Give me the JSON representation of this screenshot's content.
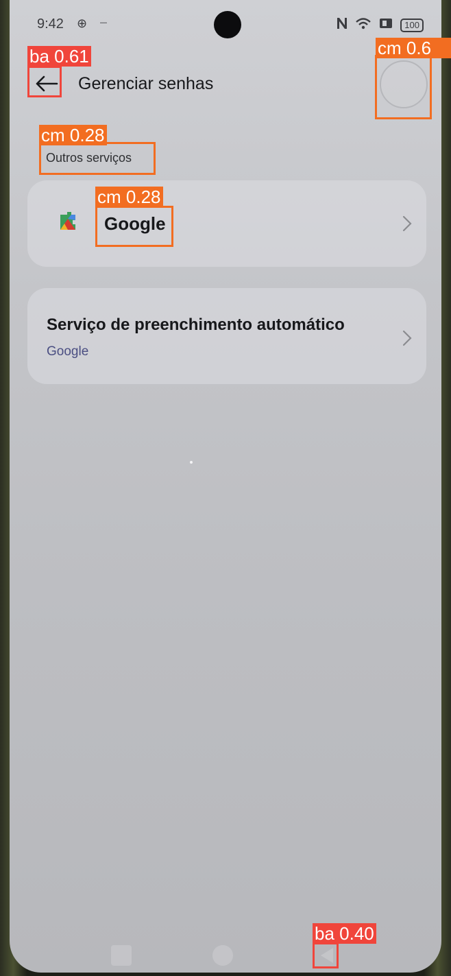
{
  "status_bar": {
    "time": "9:42",
    "sync_icon": "⊕",
    "dash": "–",
    "nfc_icon": "nfc-icon",
    "wifi_icon": "wifi-icon",
    "battery": "100"
  },
  "header": {
    "title": "Gerenciar senhas",
    "back_icon": "arrow-left-icon"
  },
  "section_label": "Outros serviços",
  "google_item": {
    "label": "Google",
    "icon": "google-play-services-icon"
  },
  "autofill_item": {
    "title": "Serviço de preenchimento automático",
    "subtitle": "Google"
  },
  "detections": [
    {
      "label": "ba 0.61",
      "color": "#f0453b"
    },
    {
      "label": "cm 0.6",
      "color": "#f26d21"
    },
    {
      "label": "cm 0.28",
      "color": "#f26d21"
    },
    {
      "label": "cm 0.28",
      "color": "#f26d21"
    },
    {
      "label": "ba 0.40",
      "color": "#f0453b"
    }
  ],
  "colors": {
    "screen_bg": "#c4c5c9",
    "text_primary": "#17181b",
    "link_blue": "#4a4e82",
    "detection_red": "#f0453b",
    "detection_orange": "#f26d21"
  }
}
